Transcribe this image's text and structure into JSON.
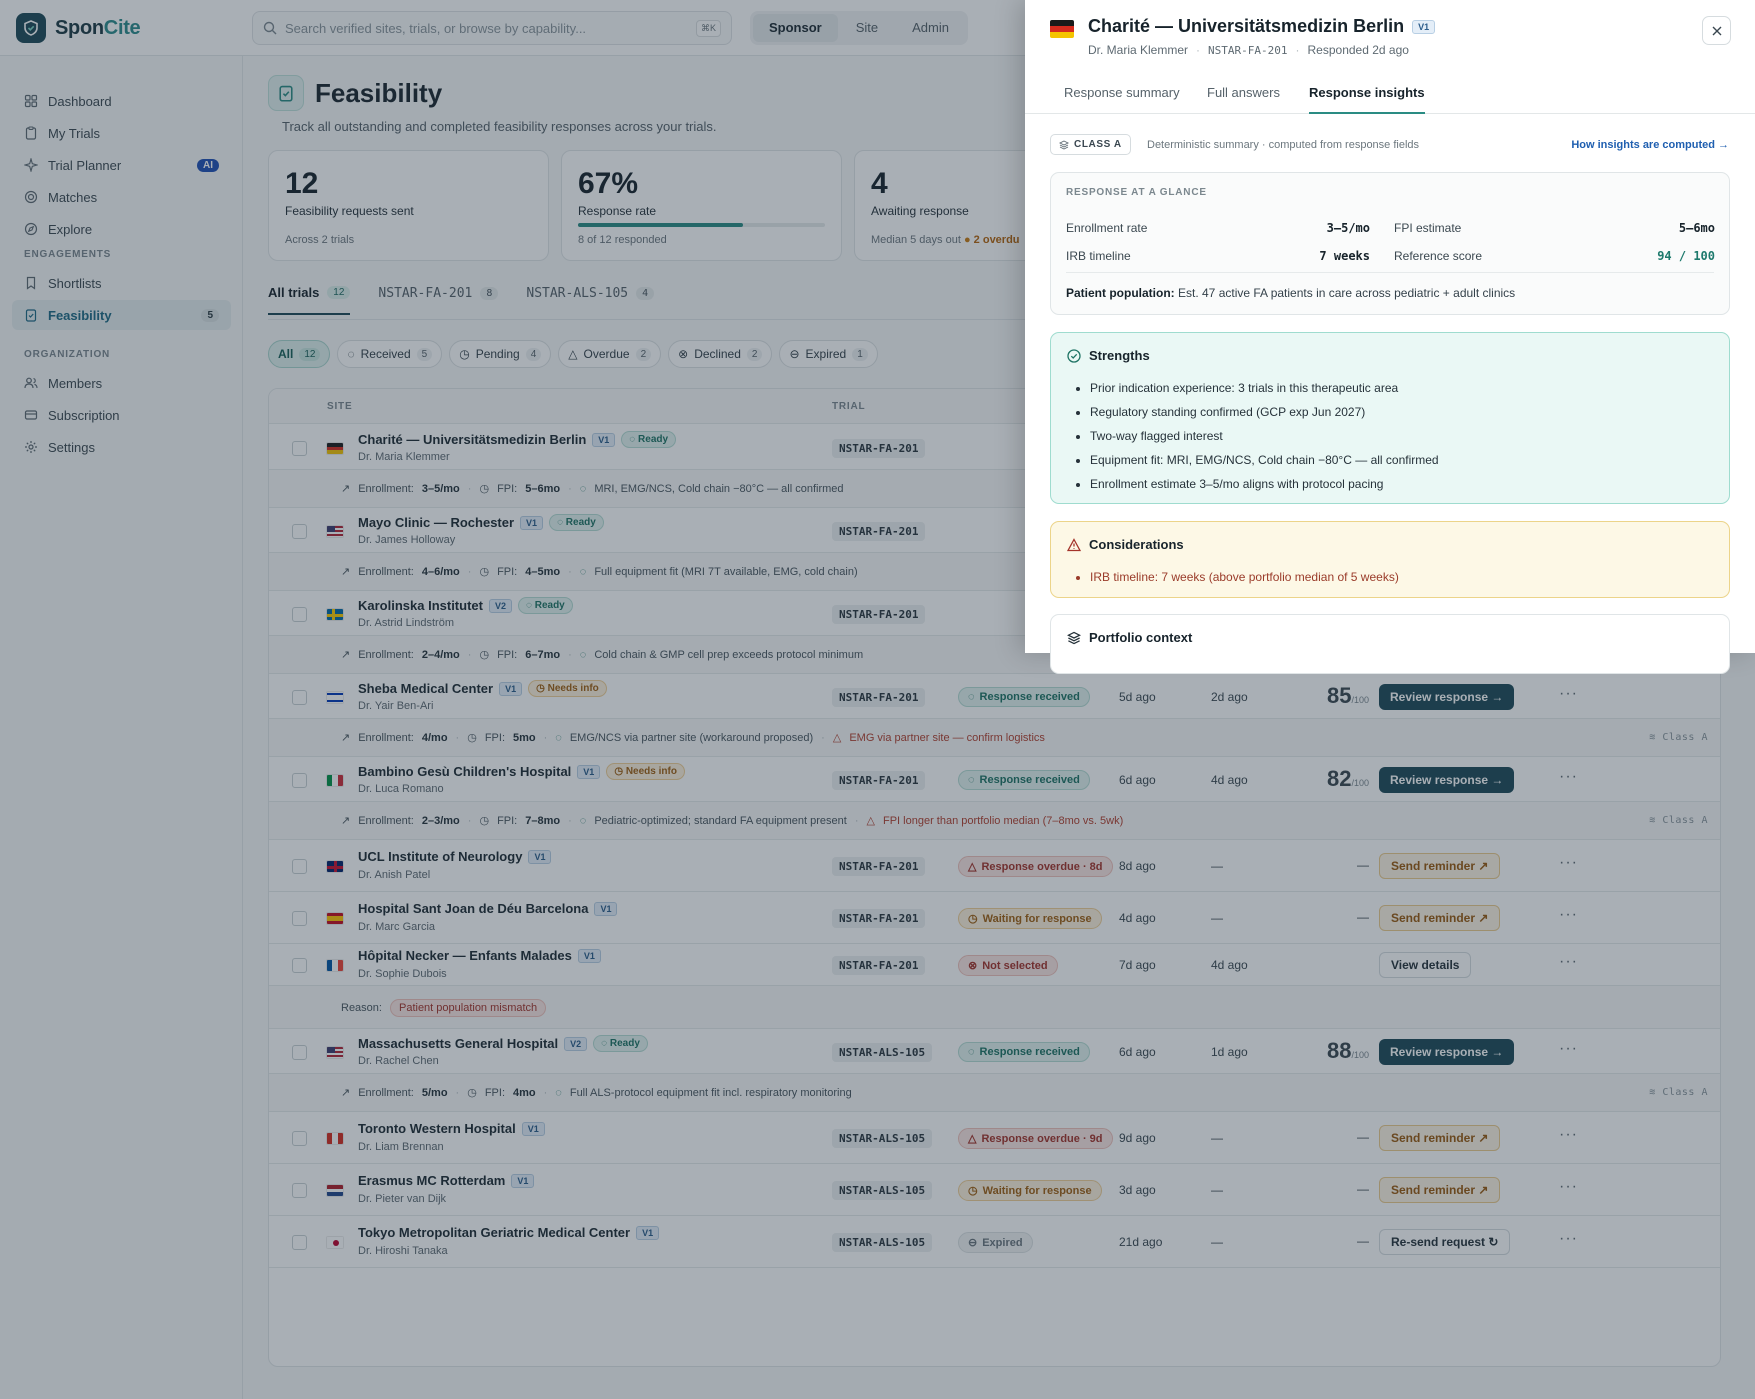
{
  "brand": {
    "name_a": "Spon",
    "name_b": "Cite"
  },
  "search": {
    "placeholder": "Search verified sites, trials, or browse by capability...",
    "shortcut": "⌘K"
  },
  "roles": [
    "Sponsor",
    "Site",
    "Admin"
  ],
  "sidebar": {
    "items": [
      {
        "label": "Dashboard",
        "icon": "grid-icon"
      },
      {
        "label": "My Trials",
        "icon": "clipboard-icon"
      },
      {
        "label": "Trial Planner",
        "icon": "sparkle-icon",
        "badge": "AI"
      },
      {
        "label": "Matches",
        "icon": "target-icon"
      },
      {
        "label": "Explore",
        "icon": "compass-icon"
      }
    ],
    "section_engagements": "ENGAGEMENTS",
    "engagements": [
      {
        "label": "Shortlists",
        "icon": "bookmark-icon"
      },
      {
        "label": "Feasibility",
        "icon": "clipboard-check-icon",
        "badge": "5"
      }
    ],
    "section_org": "ORGANIZATION",
    "org": [
      {
        "label": "Members",
        "icon": "users-icon"
      },
      {
        "label": "Subscription",
        "icon": "card-icon"
      },
      {
        "label": "Settings",
        "icon": "gear-icon"
      }
    ]
  },
  "page": {
    "title": "Feasibility",
    "subtitle": "Track all outstanding and completed feasibility responses across your trials."
  },
  "stats": [
    {
      "value": "12",
      "label": "Feasibility requests sent",
      "foot": "Across 2 trials"
    },
    {
      "value": "67%",
      "label": "Response rate",
      "foot": "8 of 12 responded",
      "progress": 0.67
    },
    {
      "value": "4",
      "label": "Awaiting response",
      "foot": "Median 5 days out",
      "foot_warn": "2 overdu"
    }
  ],
  "trial_tabs": [
    {
      "label": "All trials",
      "count": "12"
    },
    {
      "label": "NSTAR-FA-201",
      "count": "8"
    },
    {
      "label": "NSTAR-ALS-105",
      "count": "4"
    }
  ],
  "filters": [
    {
      "label": "All",
      "count": "12"
    },
    {
      "label": "Received",
      "count": "5"
    },
    {
      "label": "Pending",
      "count": "4"
    },
    {
      "label": "Overdue",
      "count": "2"
    },
    {
      "label": "Declined",
      "count": "2"
    },
    {
      "label": "Expired",
      "count": "1"
    }
  ],
  "table": {
    "headers": {
      "site": "SITE",
      "trial": "TRIAL"
    },
    "class_label": "Class A",
    "score_suffix": "/100",
    "rows": [
      {
        "name": "Charité — Universitätsmedizin Berlin",
        "version": "V1",
        "tag": "Ready",
        "doctor": "Dr. Maria Klemmer",
        "trial": "NSTAR-FA-201",
        "flag": "de",
        "sub": {
          "enroll_label": "Enrollment:",
          "enroll": "3–5/mo",
          "fpi_label": "FPI:",
          "fpi": "5–6mo",
          "note": "MRI, EMG/NCS, Cold chain −80°C — all confirmed"
        }
      },
      {
        "name": "Mayo Clinic — Rochester",
        "version": "V1",
        "tag": "Ready",
        "doctor": "Dr. James Holloway",
        "trial": "NSTAR-FA-201",
        "flag": "us",
        "sub": {
          "enroll_label": "Enrollment:",
          "enroll": "4–6/mo",
          "fpi_label": "FPI:",
          "fpi": "4–5mo",
          "note": "Full equipment fit (MRI 7T available, EMG, cold chain)"
        }
      },
      {
        "name": "Karolinska Institutet",
        "version": "V2",
        "tag": "Ready",
        "doctor": "Dr. Astrid Lindström",
        "trial": "NSTAR-FA-201",
        "flag": "se",
        "sub": {
          "enroll_label": "Enrollment:",
          "enroll": "2–4/mo",
          "fpi_label": "FPI:",
          "fpi": "6–7mo",
          "note": "Cold chain & GMP cell prep exceeds protocol minimum"
        }
      },
      {
        "name": "Sheba Medical Center",
        "version": "V1",
        "tag": "Needs info",
        "doctor": "Dr. Yair Ben-Ari",
        "trial": "NSTAR-FA-201",
        "flag": "il",
        "status": "Response received",
        "sent": "5d ago",
        "resp": "2d ago",
        "score": "85",
        "action": "Review response",
        "sub": {
          "enroll_label": "Enrollment:",
          "enroll": "4/mo",
          "fpi_label": "FPI:",
          "fpi": "5mo",
          "note": "EMG/NCS via partner site (workaround proposed)",
          "warn": "EMG via partner site — confirm logistics"
        }
      },
      {
        "name": "Bambino Gesù Children's Hospital",
        "version": "V1",
        "tag": "Needs info",
        "doctor": "Dr. Luca Romano",
        "trial": "NSTAR-FA-201",
        "flag": "it",
        "status": "Response received",
        "sent": "6d ago",
        "resp": "4d ago",
        "score": "82",
        "action": "Review response",
        "sub": {
          "enroll_label": "Enrollment:",
          "enroll": "2–3/mo",
          "fpi_label": "FPI:",
          "fpi": "7–8mo",
          "note": "Pediatric-optimized; standard FA equipment present",
          "warn": "FPI longer than portfolio median (7–8mo vs. 5wk)"
        }
      },
      {
        "name": "UCL Institute of Neurology",
        "version": "V1",
        "doctor": "Dr. Anish Patel",
        "trial": "NSTAR-FA-201",
        "flag": "gb",
        "status": "Response overdue · 8d",
        "sent": "8d ago",
        "resp": "—",
        "score_dash": "—",
        "action": "Send reminder"
      },
      {
        "name": "Hospital Sant Joan de Déu Barcelona",
        "version": "V1",
        "doctor": "Dr. Marc Garcia",
        "trial": "NSTAR-FA-201",
        "flag": "es",
        "status": "Waiting for response",
        "sent": "4d ago",
        "resp": "—",
        "score_dash": "—",
        "action": "Send reminder"
      },
      {
        "name": "Hôpital Necker — Enfants Malades",
        "version": "V1",
        "doctor": "Dr. Sophie Dubois",
        "trial": "NSTAR-FA-201",
        "flag": "fr",
        "status": "Not selected",
        "sent": "7d ago",
        "resp": "4d ago",
        "action": "View details",
        "reason_label": "Reason:",
        "reason": "Patient population mismatch"
      },
      {
        "name": "Massachusetts General Hospital",
        "version": "V2",
        "tag": "Ready",
        "doctor": "Dr. Rachel Chen",
        "trial": "NSTAR-ALS-105",
        "flag": "us",
        "status": "Response received",
        "sent": "6d ago",
        "resp": "1d ago",
        "score": "88",
        "action": "Review response",
        "sub": {
          "enroll_label": "Enrollment:",
          "enroll": "5/mo",
          "fpi_label": "FPI:",
          "fpi": "4mo",
          "note": "Full ALS-protocol equipment fit incl. respiratory monitoring"
        }
      },
      {
        "name": "Toronto Western Hospital",
        "version": "V1",
        "doctor": "Dr. Liam Brennan",
        "trial": "NSTAR-ALS-105",
        "flag": "ca",
        "status": "Response overdue · 9d",
        "sent": "9d ago",
        "resp": "—",
        "score_dash": "—",
        "action": "Send reminder"
      },
      {
        "name": "Erasmus MC Rotterdam",
        "version": "V1",
        "doctor": "Dr. Pieter van Dijk",
        "trial": "NSTAR-ALS-105",
        "flag": "nl",
        "status": "Waiting for response",
        "sent": "3d ago",
        "resp": "—",
        "score_dash": "—",
        "action": "Send reminder"
      },
      {
        "name": "Tokyo Metropolitan Geriatric Medical Center",
        "version": "V1",
        "doctor": "Dr. Hiroshi Tanaka",
        "trial": "NSTAR-ALS-105",
        "flag": "jp",
        "status": "Expired",
        "sent": "21d ago",
        "resp": "—",
        "score_dash": "—",
        "action": "Re-send request"
      }
    ]
  },
  "drawer": {
    "title": "Charité — Universitätsmedizin Berlin",
    "version": "V1",
    "doctor": "Dr. Maria Klemmer",
    "trial": "NSTAR-FA-201",
    "responded": "Responded 2d ago",
    "tabs": [
      "Response summary",
      "Full answers",
      "Response insights"
    ],
    "class_pill": "CLASS A",
    "class_desc": "Deterministic summary · computed from response fields",
    "how_link": "How insights are computed →",
    "glance_caption": "RESPONSE AT A GLANCE",
    "glance": {
      "enroll_label": "Enrollment rate",
      "enroll": "3–5/mo",
      "fpi_label": "FPI estimate",
      "fpi": "5–6mo",
      "irb_label": "IRB timeline",
      "irb": "7 weeks",
      "ref_label": "Reference score",
      "ref": "94 / 100"
    },
    "population_label": "Patient population:",
    "population": "Est. 47 active FA patients in care across pediatric + adult clinics",
    "strengths_title": "Strengths",
    "strengths": [
      "Prior indication experience: 3 trials in this therapeutic area",
      "Regulatory standing confirmed (GCP exp Jun 2027)",
      "Two-way flagged interest",
      "Equipment fit: MRI, EMG/NCS, Cold chain −80°C — all confirmed",
      "Enrollment estimate 3–5/mo aligns with protocol pacing"
    ],
    "considerations_title": "Considerations",
    "considerations": [
      "IRB timeline: 7 weeks (above portfolio median of 5 weeks)"
    ],
    "portfolio_title": "Portfolio context"
  }
}
